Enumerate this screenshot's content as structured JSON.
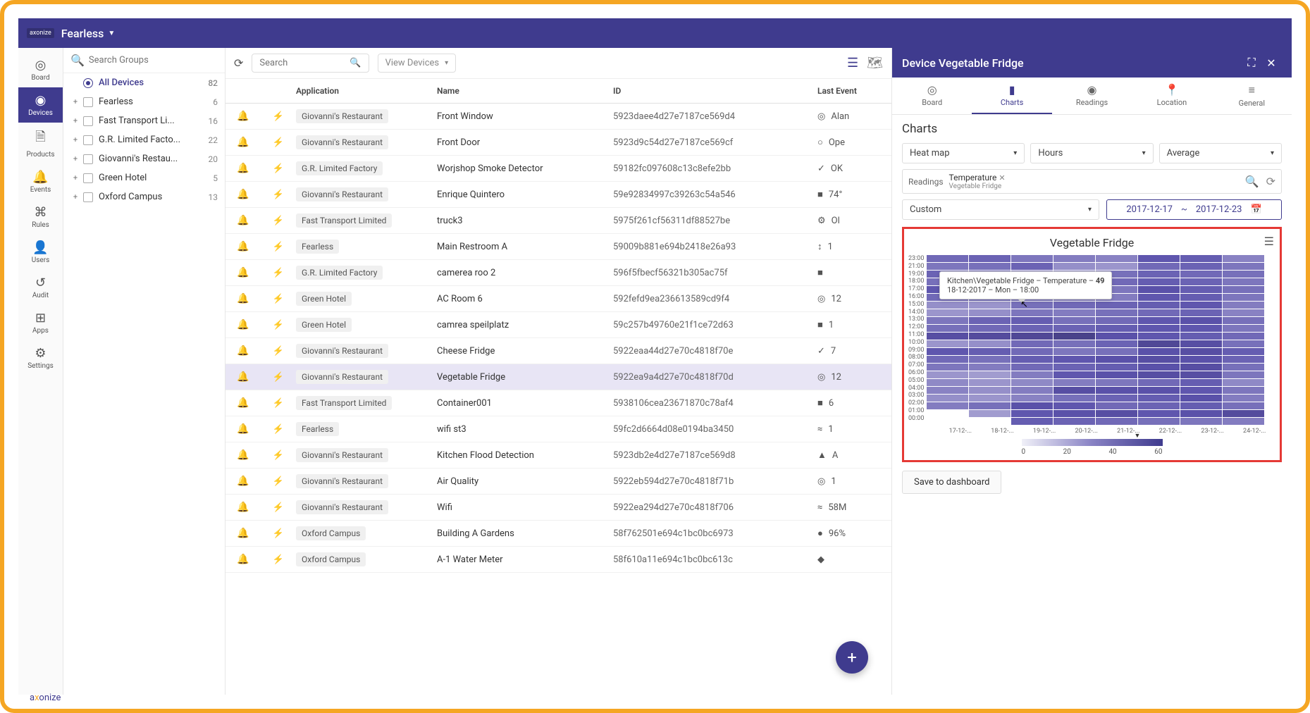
{
  "header": {
    "brand": "axonize",
    "app_name": "Fearless"
  },
  "nav_rail": [
    {
      "label": "Board",
      "icon": "◎"
    },
    {
      "label": "Devices",
      "icon": "◉"
    },
    {
      "label": "Products",
      "icon": "🗎"
    },
    {
      "label": "Events",
      "icon": "🔔"
    },
    {
      "label": "Rules",
      "icon": "⌘"
    },
    {
      "label": "Users",
      "icon": "👤"
    },
    {
      "label": "Audit",
      "icon": "↺"
    },
    {
      "label": "Apps",
      "icon": "⊞"
    },
    {
      "label": "Settings",
      "icon": "⚙"
    }
  ],
  "groups": {
    "search_placeholder": "Search Groups",
    "all_label": "All Devices",
    "all_count": 82,
    "items": [
      {
        "name": "Fearless",
        "count": 6
      },
      {
        "name": "Fast Transport Li...",
        "count": 16
      },
      {
        "name": "G.R. Limited Facto...",
        "count": 22
      },
      {
        "name": "Giovanni's Restau...",
        "count": 20
      },
      {
        "name": "Green Hotel",
        "count": 5
      },
      {
        "name": "Oxford Campus",
        "count": 13
      }
    ]
  },
  "toolbar": {
    "search_placeholder": "Search",
    "view_label": "View Devices"
  },
  "table": {
    "headers": {
      "application": "Application",
      "name": "Name",
      "id": "ID",
      "last_event": "Last Event"
    },
    "rows": [
      {
        "alarm": "red",
        "app": "Giovanni's Restaurant",
        "name": "Front Window",
        "id": "5923daee4d27e7187ce569d4",
        "last": "Alan",
        "ic": "◎"
      },
      {
        "alarm": "",
        "app": "Giovanni's Restaurant",
        "name": "Front Door",
        "id": "5923d9c54d27e7187ce569cf",
        "last": "Ope",
        "ic": "○"
      },
      {
        "alarm": "",
        "app": "G.R. Limited Factory",
        "name": "Worjshop Smoke Detector",
        "id": "59182fc097608c13c8efe2bb",
        "last": "OK",
        "ic": "✓"
      },
      {
        "alarm": "",
        "app": "Giovanni's Restaurant",
        "name": "Enrique Quintero",
        "id": "59e92834997c39263c54a546",
        "last": "74°",
        "ic": "■"
      },
      {
        "alarm": "red",
        "app": "Fast Transport Limited",
        "name": "truck3",
        "id": "5975f261cf56311df88527be",
        "last": "Ol",
        "ic": "⚙"
      },
      {
        "alarm": "",
        "app": "Fearless",
        "name": "Main Restroom A",
        "id": "59009b881e694b2418e26a93",
        "last": "1",
        "ic": "↕"
      },
      {
        "alarm": "",
        "app": "G.R. Limited Factory",
        "name": "camerea roo 2",
        "id": "596f5fbecf56321b305ac75f",
        "last": "",
        "ic": "■"
      },
      {
        "alarm": "",
        "app": "Green Hotel",
        "name": "AC Room 6",
        "id": "592fefd9ea236613589cd9f4",
        "last": "12",
        "ic": "◎"
      },
      {
        "alarm": "",
        "app": "Green Hotel",
        "name": "camrea speilplatz",
        "id": "59c257b49760e21f1ce72d63",
        "last": "1",
        "ic": "■"
      },
      {
        "alarm": "",
        "app": "Giovanni's Restaurant",
        "name": "Cheese Fridge",
        "id": "5922eaa44d27e70c4818f70e",
        "last": "7",
        "ic": "✓"
      },
      {
        "alarm": "",
        "app": "Giovanni's Restaurant",
        "name": "Vegetable Fridge",
        "id": "5922ea9a4d27e70c4818f70d",
        "last": "12",
        "ic": "◎",
        "selected": true
      },
      {
        "alarm": "red",
        "app": "Fast Transport Limited",
        "name": "Container001",
        "id": "5938106cea23671870c78af4",
        "last": "6",
        "ic": "■"
      },
      {
        "alarm": "",
        "app": "Fearless",
        "name": "wifi st3",
        "id": "59fc2d6664d08e0194ba3450",
        "last": "1",
        "ic": "≈"
      },
      {
        "alarm": "",
        "app": "Giovanni's Restaurant",
        "name": "Kitchen Flood Detection",
        "id": "5923db2e4d27e7187ce569d8",
        "last": "A",
        "ic": "▲"
      },
      {
        "alarm": "",
        "app": "Giovanni's Restaurant",
        "name": "Air Quality",
        "id": "5922eb594d27e70c4818f71b",
        "last": "1",
        "ic": "◎"
      },
      {
        "alarm": "",
        "app": "Giovanni's Restaurant",
        "name": "Wifi",
        "id": "5922ea294d27e70c4818f706",
        "last": "58M",
        "ic": "≈"
      },
      {
        "alarm": "red",
        "app": "Oxford Campus",
        "name": "Building A Gardens",
        "id": "58f762501e694c1bc0bc6973",
        "last": "96%",
        "ic": "●"
      },
      {
        "alarm": "",
        "app": "Oxford Campus",
        "name": "A-1 Water Meter",
        "id": "58f610a11e694c1bc0bc613c",
        "last": "",
        "ic": "◆"
      }
    ]
  },
  "right_panel": {
    "title": "Device Vegetable Fridge",
    "tabs": [
      {
        "label": "Board",
        "icon": "◎"
      },
      {
        "label": "Charts",
        "icon": "▮"
      },
      {
        "label": "Readings",
        "icon": "◉"
      },
      {
        "label": "Location",
        "icon": "📍"
      },
      {
        "label": "General",
        "icon": "≡"
      }
    ],
    "section": "Charts",
    "chart_type": "Heat map",
    "interval": "Hours",
    "aggregation": "Average",
    "readings_label": "Readings",
    "reading_name": "Temperature",
    "reading_source": "Vegetable Fridge",
    "date_preset": "Custom",
    "date_from": "2017-12-17",
    "date_to": "2017-12-23",
    "chart_title": "Vegetable Fridge",
    "save_label": "Save to dashboard",
    "tooltip_line1": "Kitchen\\Vegetable Fridge – Temperature – ",
    "tooltip_value": "49",
    "tooltip_line2": "18-12-2017 – Mon – 18:00"
  },
  "chart_data": {
    "type": "heatmap",
    "title": "Vegetable Fridge",
    "y_categories": [
      "23:00",
      "21:00",
      "19:00",
      "18:00",
      "17:00",
      "16:00",
      "15:00",
      "14:00",
      "13:00",
      "12:00",
      "11:00",
      "10:00",
      "09:00",
      "08:00",
      "07:00",
      "06:00",
      "05:00",
      "04:00",
      "03:00",
      "02:00",
      "01:00",
      "00:00"
    ],
    "x_categories": [
      "17-12-...",
      "18-12-...",
      "19-12-...",
      "20-12-...",
      "21-12-...",
      "22-12-...",
      "23-12-...",
      "24-12-..."
    ],
    "legend_ticks": [
      0,
      20,
      40,
      60
    ],
    "series": [
      {
        "name": "Temperature",
        "values": [
          [
            42,
            44,
            38,
            36,
            34,
            48,
            46,
            34
          ],
          [
            38,
            40,
            44,
            30,
            28,
            42,
            44,
            38
          ],
          [
            44,
            49,
            38,
            36,
            40,
            44,
            42,
            40
          ],
          [
            40,
            49,
            36,
            38,
            42,
            46,
            44,
            38
          ],
          [
            48,
            46,
            44,
            36,
            38,
            50,
            46,
            40
          ],
          [
            42,
            40,
            38,
            34,
            36,
            48,
            46,
            38
          ],
          [
            30,
            28,
            40,
            42,
            44,
            46,
            48,
            36
          ],
          [
            28,
            30,
            38,
            36,
            40,
            42,
            44,
            34
          ],
          [
            38,
            44,
            46,
            40,
            42,
            48,
            50,
            40
          ],
          [
            40,
            42,
            44,
            44,
            46,
            48,
            48,
            38
          ],
          [
            52,
            54,
            56,
            60,
            50,
            48,
            46,
            42
          ],
          [
            28,
            30,
            42,
            40,
            44,
            56,
            52,
            40
          ],
          [
            48,
            46,
            42,
            38,
            40,
            50,
            52,
            46
          ],
          [
            42,
            40,
            46,
            48,
            50,
            52,
            50,
            44
          ],
          [
            38,
            36,
            42,
            44,
            46,
            50,
            52,
            40
          ],
          [
            28,
            26,
            36,
            48,
            50,
            52,
            52,
            38
          ],
          [
            32,
            28,
            32,
            36,
            38,
            42,
            46,
            32
          ],
          [
            34,
            30,
            36,
            52,
            50,
            50,
            48,
            38
          ],
          [
            30,
            28,
            34,
            40,
            44,
            46,
            50,
            36
          ],
          [
            36,
            40,
            50,
            48,
            42,
            44,
            46,
            40
          ],
          [
            null,
            26,
            48,
            50,
            52,
            48,
            50,
            54
          ],
          [
            null,
            null,
            46,
            44,
            42,
            40,
            38,
            36
          ]
        ]
      }
    ]
  },
  "footer_brand": "axonize"
}
